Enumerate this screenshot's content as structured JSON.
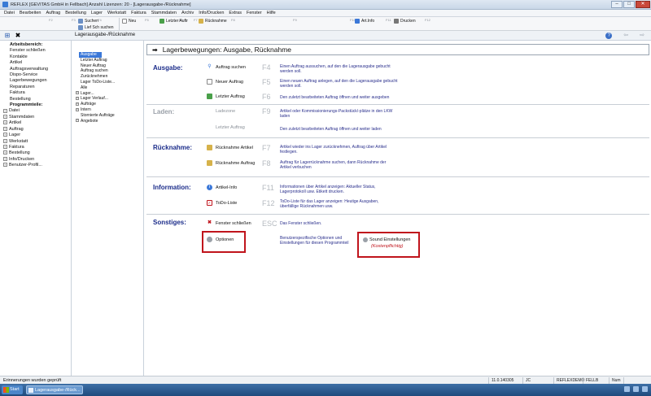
{
  "window": {
    "title": "REFLEX [GEVITAS GmbH in Fellbach] Anzahl Lizenzen: 20 - [Lagerausgabe-/Rücknahme]",
    "minimize": "–",
    "maximize": "□",
    "close": "✕"
  },
  "menu": [
    "Datei",
    "Bearbeiten",
    "Auftrag",
    "Bestellung",
    "Lager",
    "Werkstatt",
    "Faktura",
    "Stammdaten",
    "Archiv",
    "Info/Drucken",
    "Extras",
    "Fenster",
    "Hilfe"
  ],
  "toolbar": {
    "fkeys": [
      "F2",
      "F3",
      "F4",
      "F5",
      "F6",
      "F7",
      "F8",
      "F9",
      "F10",
      "F11",
      "F12"
    ],
    "suchen": "Suchen",
    "lief_sch_suchen": "Lief Sch suchen",
    "neu": "Neu",
    "letzter_auftr": "Letzter Auftr",
    "ruecknahme": "Rücknahme",
    "art_info": "Art.Info",
    "drucken": "Drucken"
  },
  "tabrow": {
    "title": "Lagerausgabe-/Rücknahme",
    "home_icon": "⊞",
    "close_icon": "✖",
    "help_label": "?",
    "back_icon": "⇦",
    "forward_icon": "⇨"
  },
  "sidebar": [
    {
      "label": "Arbeitsbereich:",
      "bold": true,
      "exp": false
    },
    {
      "label": "Fenster schließen",
      "bold": false,
      "exp": false
    },
    {
      "label": "Kontakte",
      "bold": false,
      "exp": false
    },
    {
      "label": "Artikel",
      "bold": false,
      "exp": false
    },
    {
      "label": "Auftragsverwaltung",
      "bold": false,
      "exp": false
    },
    {
      "label": "Dispo-Service",
      "bold": false,
      "exp": false
    },
    {
      "label": "Lagerbewegungen",
      "bold": false,
      "exp": false
    },
    {
      "label": "Reparaturen",
      "bold": false,
      "exp": false
    },
    {
      "label": "Faktura",
      "bold": false,
      "exp": false
    },
    {
      "label": "Bestellung",
      "bold": false,
      "exp": false
    },
    {
      "label": "Programmteile:",
      "bold": true,
      "exp": false
    },
    {
      "label": "Datei",
      "bold": false,
      "exp": true
    },
    {
      "label": "Stammdaten",
      "bold": false,
      "exp": true
    },
    {
      "label": "Artikel",
      "bold": false,
      "exp": true
    },
    {
      "label": "Auftrag",
      "bold": false,
      "exp": true
    },
    {
      "label": "Lager",
      "bold": false,
      "exp": true
    },
    {
      "label": "Werkstatt",
      "bold": false,
      "exp": true
    },
    {
      "label": "Faktura",
      "bold": false,
      "exp": true
    },
    {
      "label": "Bestellung",
      "bold": false,
      "exp": true
    },
    {
      "label": "Info/Drucken",
      "bold": false,
      "exp": true
    },
    {
      "label": "Benutzer-Profil...",
      "bold": false,
      "exp": true
    }
  ],
  "tree": [
    {
      "label": "Ausgabe",
      "sel": true,
      "exp": false
    },
    {
      "label": "Letzter Auftrag",
      "sel": false,
      "exp": false
    },
    {
      "label": "Neuer Auftrag",
      "sel": false,
      "exp": false
    },
    {
      "label": "Auftrag suchen",
      "sel": false,
      "exp": false
    },
    {
      "label": "Zurücknehmen",
      "sel": false,
      "exp": false
    },
    {
      "label": "Lager ToDo-Liste...",
      "sel": false,
      "exp": false
    },
    {
      "label": "Alle",
      "sel": false,
      "exp": false
    },
    {
      "label": "Lager...",
      "sel": false,
      "exp": true
    },
    {
      "label": "Lager Verlauf...",
      "sel": false,
      "exp": true
    },
    {
      "label": "Aufträge",
      "sel": false,
      "exp": true
    },
    {
      "label": "Intern",
      "sel": false,
      "exp": true
    },
    {
      "label": "Stornierte Aufträge",
      "sel": false,
      "exp": false
    },
    {
      "label": "Angebote",
      "sel": false,
      "exp": true
    }
  ],
  "main": {
    "arrow": "➡",
    "header_title": "Lagerbewegungen: Ausgabe, Rücknahme",
    "sections": {
      "ausgabe": "Ausgabe:",
      "laden": "Laden:",
      "ruecknahme": "Rücknahme:",
      "information": "Information:",
      "sonstiges": "Sonstiges:"
    },
    "actions": {
      "auftrag_suchen": {
        "label": "Auftrag suchen",
        "key": "F4",
        "desc": "Einen Auftrag aussuchen, auf den die Lagerausgabe gebucht werden soll."
      },
      "neuer_auftrag": {
        "label": "Neuer Auftrag",
        "key": "F5",
        "desc": "Einen neuen Auftrag anlegen, auf den die Lagerausgabe gebucht werden soll."
      },
      "letzter_auftrag": {
        "label": "Letzter Auftrag",
        "key": "F6",
        "desc": "Den zuletzt bearbeiteten Auftrag öffnen und weiter ausgeben"
      },
      "ladezone": {
        "label": "Ladezone",
        "key": "F9",
        "desc": "Artikel oder Kommissionierungs-Packstück/-plätze in den LKW laden"
      },
      "letzter_auftrag_laden": {
        "label": "Letzter Auftrag",
        "key": "",
        "desc": "Den zuletzt bearbeiteten Auftrag öffnen und weiter laden"
      },
      "ruecknahme_artikel": {
        "label": "Rücknahme Artikel",
        "key": "F7",
        "desc": "Artikel wieder ins Lager zurücknehmen, Auftrag über Artikel festlegen."
      },
      "ruecknahme_auftrag": {
        "label": "Rücknahme Auftrag",
        "key": "F8",
        "desc": "Auftrag für Lagerrücknahme suchen, dann Rücknahme der Artikel verbuchen"
      },
      "artikel_info": {
        "label": "Artikel-Info",
        "key": "F11",
        "desc": "Informationen über Artikel anzeigen: Aktueller Status, Lagerprotokoll usw. Etikett drucken."
      },
      "todo_liste": {
        "label": "ToDo-Liste",
        "key": "F12",
        "desc": "ToDo-Liste für das Lager anzeigen: Heutige Ausgaben, überfällige Rücknahmen usw."
      },
      "fenster_schliessen": {
        "label": "Fenster schließen",
        "key": "ESC",
        "desc": "Das Fenster schließen."
      },
      "optionen": {
        "label": "Optionen",
        "key": "",
        "desc": "Benutzerspezifische Optionen und Einstellungen für diesen Programmteil"
      }
    },
    "sound": {
      "label": "Sound Einstellungen",
      "sub": "(Kostenpflichtig)"
    }
  },
  "statusbar": {
    "message": "Erinnerungen wurden geprüft",
    "version": "11.0.140305",
    "user": "JC",
    "db": "REFLEXDEMO",
    "site": "FELLB",
    "num": "Num"
  },
  "taskbar": {
    "start": "Start",
    "task": "Lagerausgabe-/Rück..."
  }
}
